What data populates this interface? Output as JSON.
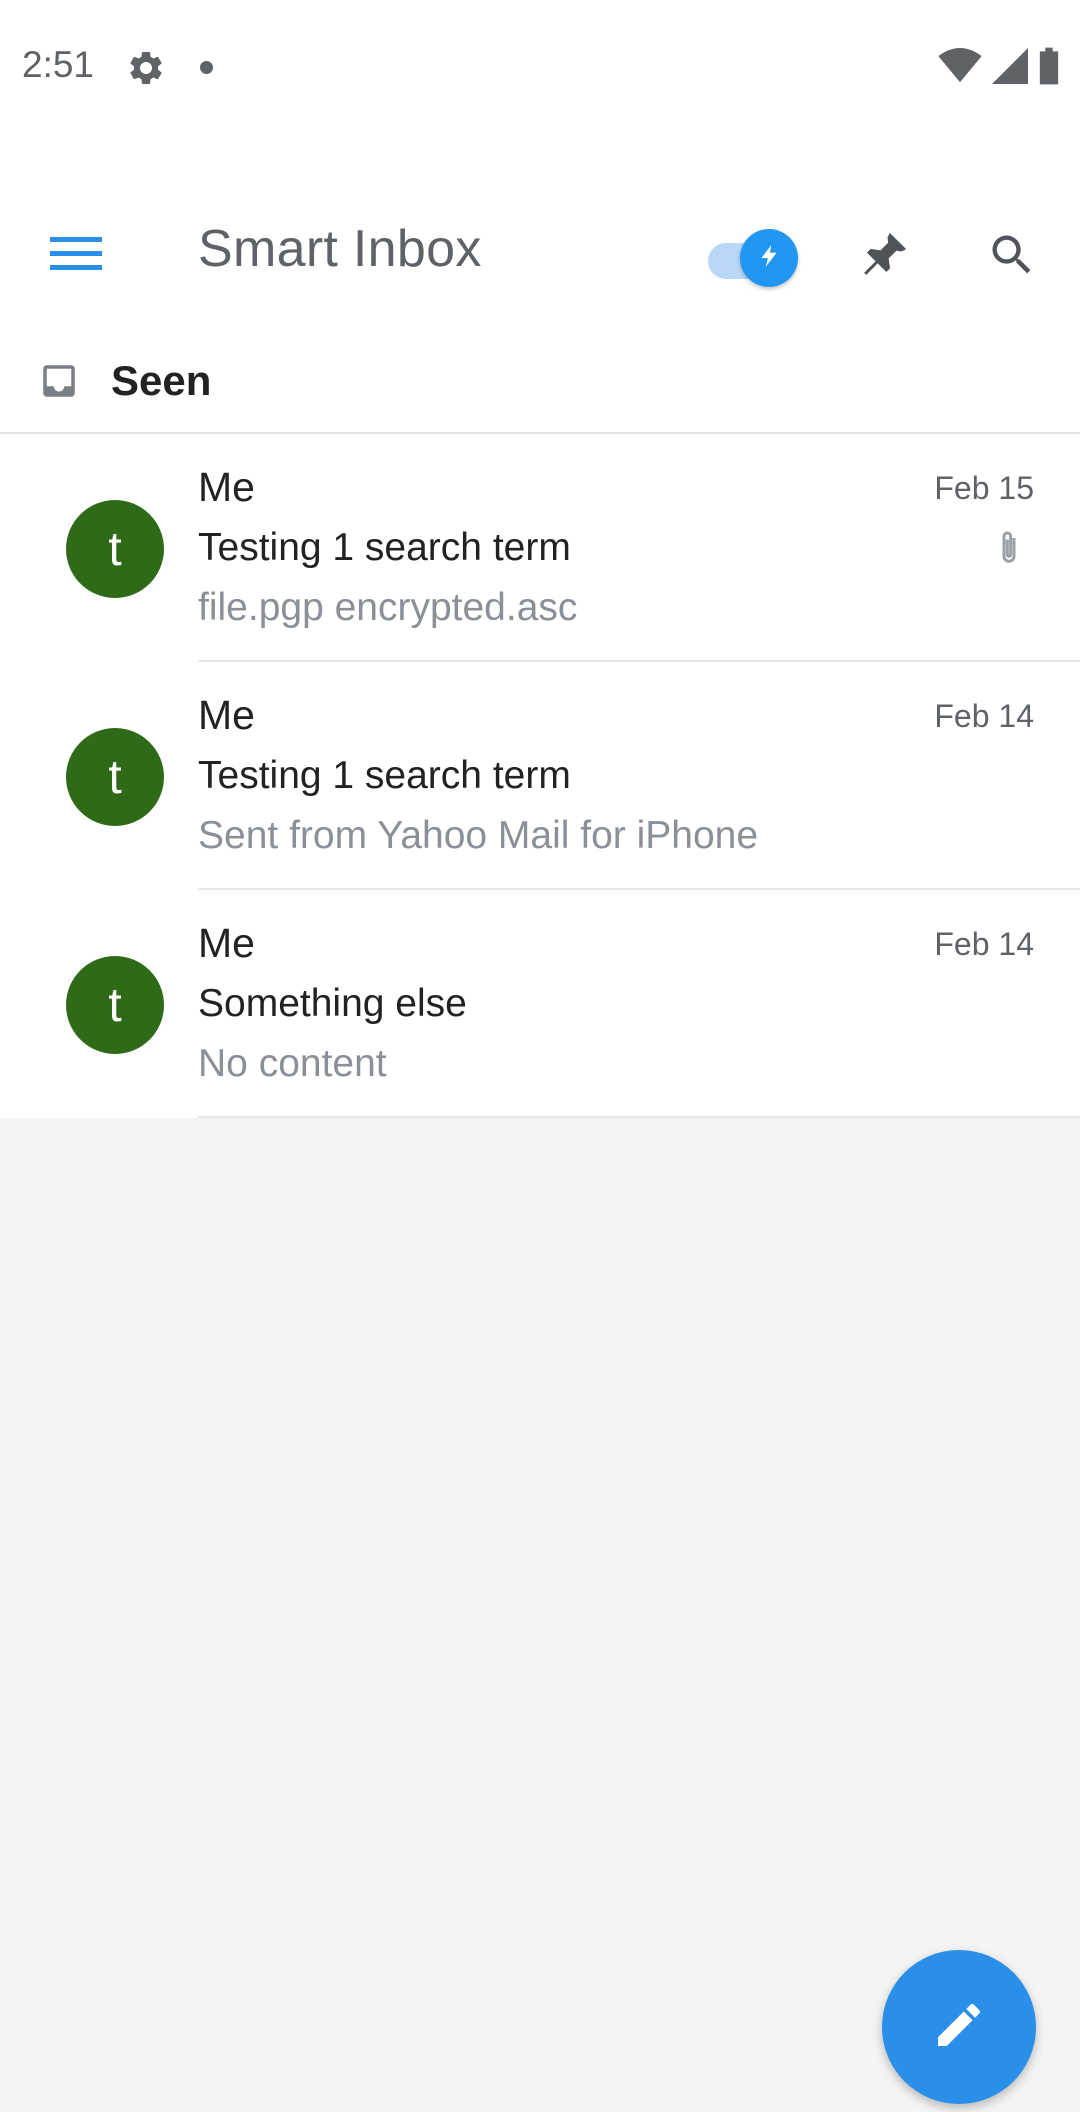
{
  "status_bar": {
    "time": "2:51",
    "icons": [
      "gear-icon",
      "notification-dot-icon",
      "wifi-icon",
      "signal-icon",
      "battery-icon"
    ]
  },
  "app_bar": {
    "title": "Smart Inbox",
    "menu_icon": "hamburger-menu-icon",
    "toggle_icon": "lightning-bolt-icon",
    "toggle_on": true,
    "pin_icon": "pin-icon",
    "search_icon": "search-icon"
  },
  "folder": {
    "name": "Seen",
    "icon": "inbox-icon"
  },
  "messages": [
    {
      "avatar_letter": "t",
      "sender": "Me",
      "date": "Feb 15",
      "subject": "Testing 1 search term",
      "preview": "file.pgp encrypted.asc",
      "has_attachment": true
    },
    {
      "avatar_letter": "t",
      "sender": "Me",
      "date": "Feb 14",
      "subject": "Testing 1 search term",
      "preview": "Sent from Yahoo Mail for iPhone",
      "has_attachment": false
    },
    {
      "avatar_letter": "t",
      "sender": "Me",
      "date": "Feb 14",
      "subject": "Something else",
      "preview": "No content",
      "has_attachment": false
    }
  ],
  "fab": {
    "icon": "pencil-icon"
  },
  "colors": {
    "accent": "#2196f3",
    "avatar": "#2e6a17",
    "background": "#f4f4f5",
    "icon_gray": "#5f6368"
  }
}
